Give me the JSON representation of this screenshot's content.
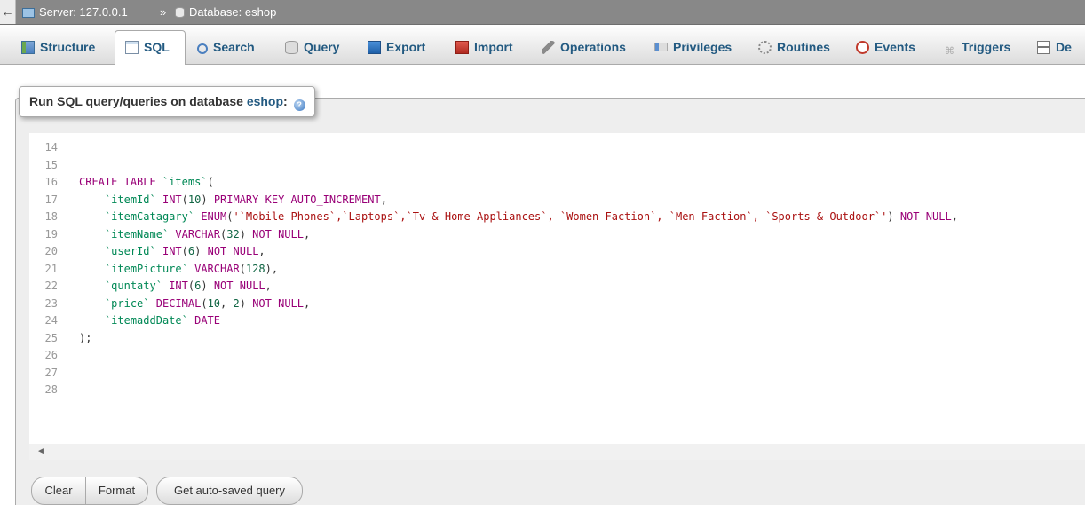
{
  "breadcrumb": {
    "back": "←",
    "server": "Server: 127.0.0.1",
    "separator": "»",
    "database": "Database: eshop"
  },
  "tabs": [
    {
      "label": "Structure",
      "icon": "structure-icon"
    },
    {
      "label": "SQL",
      "icon": "sql-icon",
      "active": true
    },
    {
      "label": "Search",
      "icon": "search-icon"
    },
    {
      "label": "Query",
      "icon": "query-icon"
    },
    {
      "label": "Export",
      "icon": "export-icon"
    },
    {
      "label": "Import",
      "icon": "import-icon"
    },
    {
      "label": "Operations",
      "icon": "operations-icon"
    },
    {
      "label": "Privileges",
      "icon": "privileges-icon"
    },
    {
      "label": "Routines",
      "icon": "routines-icon"
    },
    {
      "label": "Events",
      "icon": "events-icon"
    },
    {
      "label": "Triggers",
      "icon": "triggers-icon"
    },
    {
      "label": "De",
      "icon": "designer-icon"
    }
  ],
  "panel": {
    "title_prefix": "Run SQL query/queries on database",
    "database": "eshop",
    "help_icon": "help-icon"
  },
  "editor": {
    "lines": [
      {
        "n": "14",
        "code": ""
      },
      {
        "n": "15",
        "code": ""
      },
      {
        "n": "16",
        "code": "CREATE TABLE `items`("
      },
      {
        "n": "17",
        "code": "    `itemId` INT(10) PRIMARY KEY AUTO_INCREMENT,"
      },
      {
        "n": "18",
        "code": "    `itemCatagary` ENUM('`Mobile Phones`,`Laptops`,`Tv & Home Appliances`, `Women Faction`, `Men Faction`, `Sports & Outdoor`') NOT NULL,"
      },
      {
        "n": "19",
        "code": "    `itemName` VARCHAR(32) NOT NULL,"
      },
      {
        "n": "20",
        "code": "    `userId` INT(6) NOT NULL,"
      },
      {
        "n": "21",
        "code": "    `itemPicture` VARCHAR(128),"
      },
      {
        "n": "22",
        "code": "    `quntaty` INT(6) NOT NULL,"
      },
      {
        "n": "23",
        "code": "    `price` DECIMAL(10, 2) NOT NULL,"
      },
      {
        "n": "24",
        "code": "    `itemaddDate` DATE"
      },
      {
        "n": "25",
        "code": ");"
      },
      {
        "n": "26",
        "code": ""
      },
      {
        "n": "27",
        "code": ""
      },
      {
        "n": "28",
        "code": ""
      }
    ],
    "scroll_left_arrow": "◄"
  },
  "buttons": {
    "clear": "Clear",
    "format": "Format",
    "autosaved": "Get auto-saved query"
  },
  "colors": {
    "keyword": "#990077",
    "backtick_name": "#008855",
    "string": "#aa1111",
    "number": "#116644",
    "link": "#235a81"
  }
}
